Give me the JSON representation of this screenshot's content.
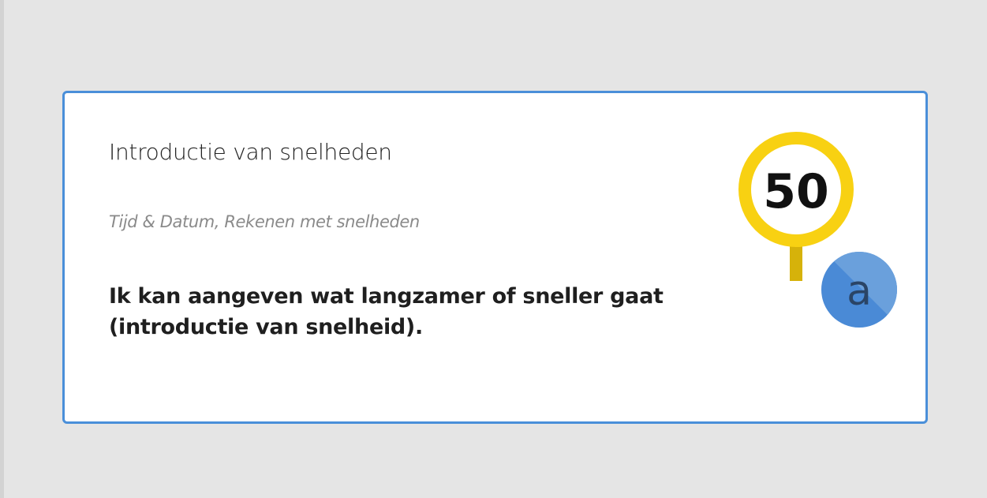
{
  "card": {
    "title": "Introductie van snelheden",
    "tags": "Tijd & Datum, Rekenen met snelheden",
    "goal": "Ik kan aangeven wat langzamer of sneller gaat (introductie van snelheid).",
    "icon": {
      "sign_text": "50",
      "badge_text": "a"
    }
  },
  "colors": {
    "border": "#4a8fd9",
    "sign_ring": "#f8d112",
    "sign_post": "#d6b20a",
    "badge": "#4a8ad6",
    "badge_light": "#6aa0dc",
    "badge_text": "#2a4466"
  }
}
